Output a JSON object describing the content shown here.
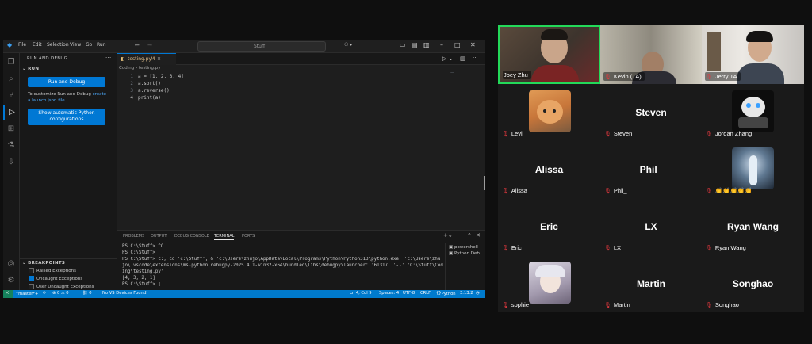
{
  "vscode": {
    "menu": [
      "File",
      "Edit",
      "Selection",
      "View",
      "Go",
      "Run",
      "···"
    ],
    "search": "Stuff",
    "sidebar": {
      "title": "RUN AND DEBUG",
      "section": "RUN",
      "run_button": "Run and Debug",
      "customize_text": "To customize Run and Debug",
      "customize_link": "create a launch.json file.",
      "show_python_button_line1": "Show automatic Python",
      "show_python_button_line2": "configurations",
      "breakpoints_title": "BREAKPOINTS",
      "breakpoints": [
        {
          "label": "Raised Exceptions",
          "checked": false
        },
        {
          "label": "Uncaught Exceptions",
          "checked": true
        },
        {
          "label": "User Uncaught Exceptions",
          "checked": false
        }
      ]
    },
    "editor": {
      "tab": "testing.py",
      "tab_badge": "M",
      "breadcrumb": "Coding › testing.py",
      "line_numbers": [
        "1",
        "2",
        "3",
        "4"
      ],
      "code_lines": [
        "a = [1, 2, 3, 4]",
        "a.sort()",
        "a.reverse()",
        "print(a)"
      ]
    },
    "panel": {
      "tabs": [
        "PROBLEMS",
        "OUTPUT",
        "DEBUG CONSOLE",
        "TERMINAL",
        "PORTS"
      ],
      "active_tab": "TERMINAL",
      "terminal_lines": [
        "PS C:\\Stuff> ^C",
        "PS C:\\Stuff>",
        "PS C:\\Stuff> c:; cd 'c:\\Stuff'; & 'c:\\Users\\zhujo\\AppData\\Local\\Programs\\Python\\Python313\\python.exe' 'c:\\Users\\zhu",
        "jo\\.vscode\\extensions\\ms-python.debugpy-2025.4.1-win32-x64\\bundled\\libs\\debugpy\\launcher' '61317' '--' 'C:\\Stuff\\Cod",
        "ing\\testing.py'",
        "[4, 3, 2, 1]",
        "PS C:\\Stuff> ▯"
      ],
      "terminals": [
        "powershell",
        "Python Deb..."
      ]
    },
    "status": {
      "branch": "master*+",
      "sync": "⟳",
      "errors": "⊗ 0 ⚠ 0",
      "ports": "⛓ 0",
      "devices": "No VS Devices Found!",
      "position": "Ln 4, Col 9",
      "spaces": "Spaces: 4",
      "encoding": "UTF-8",
      "eol": "CRLF",
      "language": "Python",
      "version": "3.13.2",
      "bell": "🔔"
    }
  },
  "zoom": {
    "participants": [
      {
        "name": "Joey Zhu",
        "type": "video",
        "speaking": true
      },
      {
        "name": "Kevin (TA)",
        "type": "video"
      },
      {
        "name": "Jerry TA",
        "type": "video"
      },
      {
        "name": "Levi",
        "type": "avatar"
      },
      {
        "name": "Steven",
        "big": "Steven"
      },
      {
        "name": "Jordan Zhang",
        "type": "avatar"
      },
      {
        "name": "Alissa",
        "big": "Alissa"
      },
      {
        "name": "Phil_",
        "big": "Phil_"
      },
      {
        "name": "👏👏👏👏👏",
        "type": "avatar"
      },
      {
        "name": "Eric",
        "big": "Eric"
      },
      {
        "name": "LX",
        "big": "LX"
      },
      {
        "name": "Ryan Wang",
        "big": "Ryan Wang"
      },
      {
        "name": "sophie",
        "type": "avatar"
      },
      {
        "name": "Martin",
        "big": "Martin"
      },
      {
        "name": "Songhao",
        "big": "Songhao"
      }
    ],
    "colors": {
      "speaking_border": "#23d959",
      "muted_icon": "#e0383e"
    }
  }
}
